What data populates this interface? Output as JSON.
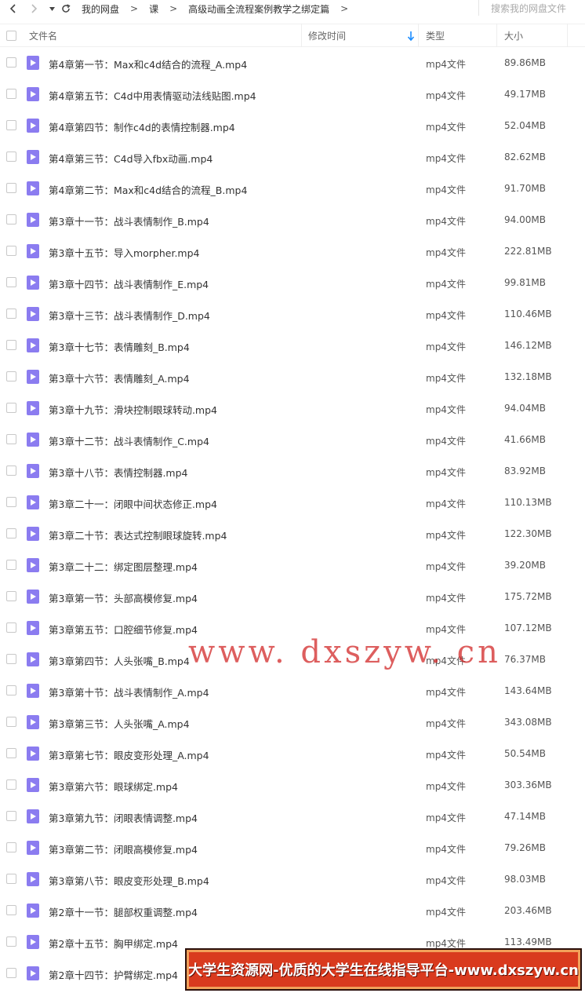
{
  "breadcrumb": [
    "我的网盘",
    "课",
    "高级动画全流程案例教学之绑定篇"
  ],
  "search": {
    "placeholder": "搜索我的网盘文件"
  },
  "columns": {
    "name": "文件名",
    "modified": "修改时间",
    "type": "类型",
    "size": "大小"
  },
  "colors": {
    "file_icon": "#8b7cf0",
    "sort_arrow": "#1a8cff",
    "banner_bg": "#d93a1e",
    "watermark": "#d22828"
  },
  "files": [
    {
      "name": "第4章第一节：Max和c4d结合的流程_A.mp4",
      "type": "mp4文件",
      "size": "89.86MB"
    },
    {
      "name": "第4章第五节：C4d中用表情驱动法线贴图.mp4",
      "type": "mp4文件",
      "size": "49.17MB"
    },
    {
      "name": "第4章第四节：制作c4d的表情控制器.mp4",
      "type": "mp4文件",
      "size": "52.04MB"
    },
    {
      "name": "第4章第三节：C4d导入fbx动画.mp4",
      "type": "mp4文件",
      "size": "82.62MB"
    },
    {
      "name": "第4章第二节：Max和c4d结合的流程_B.mp4",
      "type": "mp4文件",
      "size": "91.70MB"
    },
    {
      "name": "第3章十一节：战斗表情制作_B.mp4",
      "type": "mp4文件",
      "size": "94.00MB"
    },
    {
      "name": "第3章十五节：导入morpher.mp4",
      "type": "mp4文件",
      "size": "222.81MB"
    },
    {
      "name": "第3章十四节：战斗表情制作_E.mp4",
      "type": "mp4文件",
      "size": "99.81MB"
    },
    {
      "name": "第3章十三节：战斗表情制作_D.mp4",
      "type": "mp4文件",
      "size": "110.46MB"
    },
    {
      "name": "第3章十七节：表情雕刻_B.mp4",
      "type": "mp4文件",
      "size": "146.12MB"
    },
    {
      "name": "第3章十六节：表情雕刻_A.mp4",
      "type": "mp4文件",
      "size": "132.18MB"
    },
    {
      "name": "第3章十九节：滑块控制眼球转动.mp4",
      "type": "mp4文件",
      "size": "94.04MB"
    },
    {
      "name": "第3章十二节：战斗表情制作_C.mp4",
      "type": "mp4文件",
      "size": "41.66MB"
    },
    {
      "name": "第3章十八节：表情控制器.mp4",
      "type": "mp4文件",
      "size": "83.92MB"
    },
    {
      "name": "第3章二十一：闭眼中间状态修正.mp4",
      "type": "mp4文件",
      "size": "110.13MB"
    },
    {
      "name": "第3章二十节：表达式控制眼球旋转.mp4",
      "type": "mp4文件",
      "size": "122.30MB"
    },
    {
      "name": "第3章二十二：绑定图层整理.mp4",
      "type": "mp4文件",
      "size": "39.20MB"
    },
    {
      "name": "第3章第一节：头部高模修复.mp4",
      "type": "mp4文件",
      "size": "175.72MB"
    },
    {
      "name": "第3章第五节：口腔细节修复.mp4",
      "type": "mp4文件",
      "size": "107.12MB"
    },
    {
      "name": "第3章第四节：人头张嘴_B.mp4",
      "type": "mp4文件",
      "size": "76.37MB"
    },
    {
      "name": "第3章第十节：战斗表情制作_A.mp4",
      "type": "mp4文件",
      "size": "143.64MB"
    },
    {
      "name": "第3章第三节：人头张嘴_A.mp4",
      "type": "mp4文件",
      "size": "343.08MB"
    },
    {
      "name": "第3章第七节：眼皮变形处理_A.mp4",
      "type": "mp4文件",
      "size": "50.54MB"
    },
    {
      "name": "第3章第六节：眼球绑定.mp4",
      "type": "mp4文件",
      "size": "303.36MB"
    },
    {
      "name": "第3章第九节：闭眼表情调整.mp4",
      "type": "mp4文件",
      "size": "47.14MB"
    },
    {
      "name": "第3章第二节：闭眼高模修复.mp4",
      "type": "mp4文件",
      "size": "79.26MB"
    },
    {
      "name": "第3章第八节：眼皮变形处理_B.mp4",
      "type": "mp4文件",
      "size": "98.03MB"
    },
    {
      "name": "第2章十一节：腿部权重调整.mp4",
      "type": "mp4文件",
      "size": "203.46MB"
    },
    {
      "name": "第2章十五节：胸甲绑定.mp4",
      "type": "mp4文件",
      "size": "113.49MB"
    },
    {
      "name": "第2章十四节：护臂绑定.mp4",
      "type": "",
      "size": ""
    }
  ],
  "watermark": "www. dxszyw. cn",
  "banner": "大学生资源网-优质的大学生在线指导平台-www.dxszyw.cn"
}
